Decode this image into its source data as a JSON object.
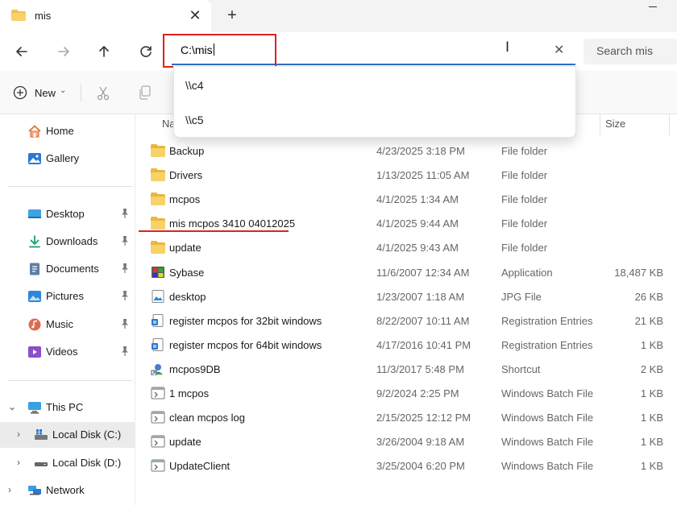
{
  "tab": {
    "title": "mis",
    "close_glyph": "✕",
    "new_tab_glyph": "+"
  },
  "address": {
    "value": "C:\\mis",
    "clear_glyph": "✕"
  },
  "search": {
    "placeholder": "Search mis"
  },
  "command_bar": {
    "new_label": "New",
    "new_chevron": "⌄"
  },
  "suggestions": [
    {
      "label": "\\\\c4"
    },
    {
      "label": "\\\\c5"
    }
  ],
  "sidebar": {
    "quick": [
      {
        "label": "Home",
        "icon": "home-icon"
      },
      {
        "label": "Gallery",
        "icon": "gallery-icon"
      }
    ],
    "pinned": [
      {
        "label": "Desktop",
        "icon": "desktop-icon"
      },
      {
        "label": "Downloads",
        "icon": "download-icon"
      },
      {
        "label": "Documents",
        "icon": "documents-icon"
      },
      {
        "label": "Pictures",
        "icon": "pictures-icon"
      },
      {
        "label": "Music",
        "icon": "music-icon"
      },
      {
        "label": "Videos",
        "icon": "videos-icon"
      }
    ],
    "this_pc": {
      "label": "This PC",
      "expanded_glyph": "⌄"
    },
    "drives": [
      {
        "label": "Local Disk (C:)",
        "selected": true
      },
      {
        "label": "Local Disk (D:)",
        "selected": false
      }
    ],
    "network": {
      "label": "Network"
    },
    "collapsed_glyph": "›"
  },
  "columns": {
    "name": "Name",
    "name_visible": "Na",
    "size": "Size"
  },
  "files": [
    {
      "name": "Backup",
      "date": "4/23/2025 3:18 PM",
      "type": "File folder",
      "size": "",
      "icon": "folder-icon"
    },
    {
      "name": "Drivers",
      "date": "1/13/2025 11:05 AM",
      "type": "File folder",
      "size": "",
      "icon": "folder-icon"
    },
    {
      "name": "mcpos",
      "date": "4/1/2025 1:34 AM",
      "type": "File folder",
      "size": "",
      "icon": "folder-icon"
    },
    {
      "name": "mis mcpos 3410 04012025",
      "date": "4/1/2025 9:44 AM",
      "type": "File folder",
      "size": "",
      "icon": "folder-icon"
    },
    {
      "name": "update",
      "date": "4/1/2025 9:43 AM",
      "type": "File folder",
      "size": "",
      "icon": "folder-icon"
    },
    {
      "name": "Sybase",
      "date": "11/6/2007 12:34 AM",
      "type": "Application",
      "size": "18,487 KB",
      "icon": "application-icon"
    },
    {
      "name": "desktop",
      "date": "1/23/2007 1:18 AM",
      "type": "JPG File",
      "size": "26 KB",
      "icon": "image-icon"
    },
    {
      "name": "register mcpos for 32bit windows",
      "date": "8/22/2007 10:11 AM",
      "type": "Registration Entries",
      "size": "21 KB",
      "icon": "registry-icon"
    },
    {
      "name": "register mcpos for 64bit windows",
      "date": "4/17/2016 10:41 PM",
      "type": "Registration Entries",
      "size": "1 KB",
      "icon": "registry-icon"
    },
    {
      "name": "mcpos9DB",
      "date": "11/3/2017 5:48 PM",
      "type": "Shortcut",
      "size": "2 KB",
      "icon": "shortcut-icon"
    },
    {
      "name": "1 mcpos",
      "date": "9/2/2024 2:25 PM",
      "type": "Windows Batch File",
      "size": "1 KB",
      "icon": "batch-file-icon"
    },
    {
      "name": "clean mcpos log",
      "date": "2/15/2025 12:12 PM",
      "type": "Windows Batch File",
      "size": "1 KB",
      "icon": "batch-file-icon"
    },
    {
      "name": "update",
      "date": "3/26/2004 9:18 AM",
      "type": "Windows Batch File",
      "size": "1 KB",
      "icon": "batch-file-icon"
    },
    {
      "name": "UpdateClient",
      "date": "3/25/2004 6:20 PM",
      "type": "Windows Batch File",
      "size": "1 KB",
      "icon": "batch-file-icon"
    }
  ],
  "colors": {
    "accent": "#2f6fc4",
    "highlight_red": "#e02020",
    "folder": "#f2c14e"
  }
}
